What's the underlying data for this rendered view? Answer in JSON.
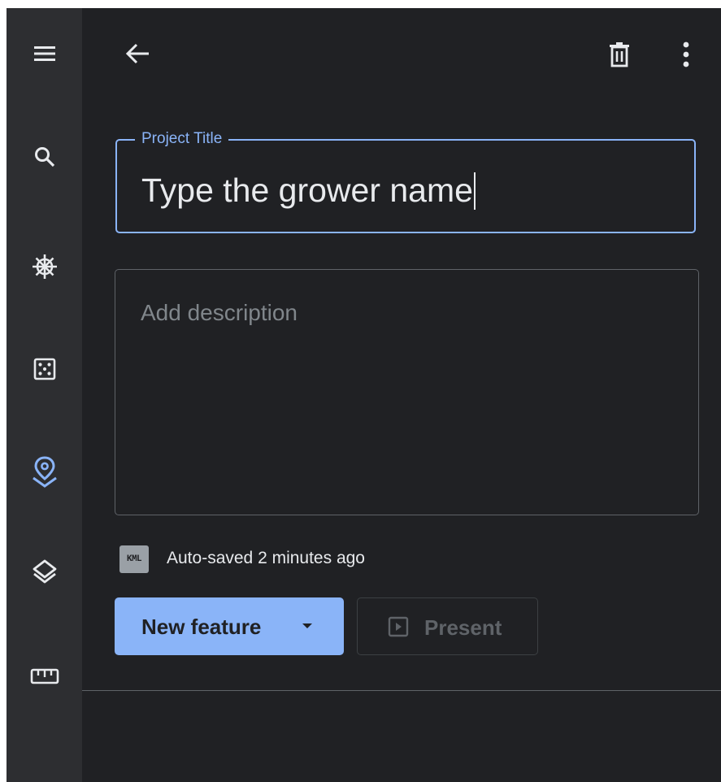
{
  "rail": {
    "items": [
      {
        "name": "menu",
        "icon": "menu-icon"
      },
      {
        "name": "search",
        "icon": "search-icon"
      },
      {
        "name": "voyager",
        "icon": "helm-icon"
      },
      {
        "name": "feeling-lucky",
        "icon": "dice-icon"
      },
      {
        "name": "projects",
        "icon": "map-pin-icon",
        "active": true
      },
      {
        "name": "map-style",
        "icon": "layers-icon"
      },
      {
        "name": "measure",
        "icon": "ruler-icon"
      }
    ]
  },
  "header": {
    "back_icon": "arrow-back-icon",
    "delete_icon": "trash-icon",
    "more_icon": "more-vert-icon"
  },
  "project": {
    "title_label": "Project Title",
    "title_value": "Type the grower name",
    "description_placeholder": "Add description",
    "file_badge": "KML",
    "autosave_status": "Auto-saved 2 minutes ago"
  },
  "actions": {
    "new_feature_label": "New feature",
    "present_label": "Present"
  },
  "colors": {
    "background": "#202124",
    "rail": "#2d2e31",
    "accent": "#8ab4f8",
    "text": "#e8eaed",
    "muted": "#80868b",
    "disabled": "#5f6368"
  }
}
